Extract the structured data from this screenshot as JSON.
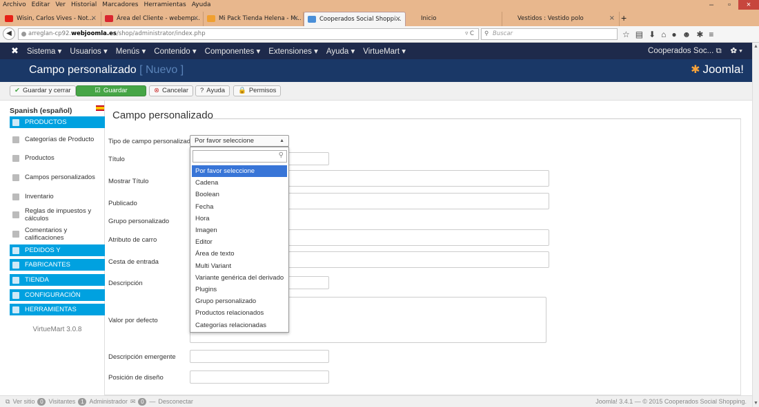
{
  "menubar": [
    "Archivo",
    "Editar",
    "Ver",
    "Historial",
    "Marcadores",
    "Herramientas",
    "Ayuda"
  ],
  "window_controls": {
    "minimize": "–",
    "restore": "▫",
    "close": "×"
  },
  "tabs": [
    {
      "title": "Wisin, Carlos Vives - Not...",
      "icon_color": "#e62117",
      "icon": "youtube-icon"
    },
    {
      "title": "Área del Cliente - webemp...",
      "icon_color": "#d9262f",
      "icon": "webempresa-icon"
    },
    {
      "title": "Mi Pack Tienda Helena - M...",
      "icon_color": "#f0a030",
      "icon": "pack-icon"
    },
    {
      "title": "Cooperados Social Shoppi...",
      "icon_color": "#4a8fd8",
      "icon": "joomla-icon"
    },
    {
      "title": "Inicio",
      "icon_color": "",
      "icon": ""
    },
    {
      "title": "Vestidos : Vestido polo",
      "icon_color": "",
      "icon": ""
    }
  ],
  "new_tab": "+",
  "url": {
    "prefix": "arreglan-cp92.",
    "domain": "webjoomla.es",
    "path": "/shop/administrator/index.php",
    "reload": "▿ C"
  },
  "search": {
    "placeholder": "Buscar",
    "icon": "⚲"
  },
  "nav_icons": [
    "☆",
    "▤",
    "⬇",
    "⌂",
    "●",
    "☻",
    "✱",
    "≡"
  ],
  "jnav": {
    "logo": "✖",
    "items": [
      "Sistema ▾",
      "Usuarios ▾",
      "Menús ▾",
      "Contenido ▾",
      "Componentes ▾",
      "Extensiones ▾",
      "Ayuda ▾",
      "VirtueMart ▾"
    ],
    "site": "Cooperados Soc... ⧉",
    "settings": "✿ ▾"
  },
  "header": {
    "title": "Campo personalizado",
    "status": "[ Nuevo ]",
    "logo": "Joomla!"
  },
  "toolbar": [
    {
      "label": "Guardar y cerrar",
      "icon": "✔"
    },
    {
      "label": "Guardar",
      "icon": "☑"
    },
    {
      "label": "Cancelar",
      "icon": "⊗"
    },
    {
      "label": "Ayuda",
      "icon": "?"
    },
    {
      "label": "Permisos",
      "icon": "🔒"
    }
  ],
  "sidebar": {
    "language": "Spanish (español)",
    "items": [
      {
        "label": "PRODUCTOS",
        "type": "cat"
      },
      {
        "label": "Categorías de Producto",
        "type": "item"
      },
      {
        "label": "Productos",
        "type": "item"
      },
      {
        "label": "Campos personalizados",
        "type": "item"
      },
      {
        "label": "Inventario",
        "type": "item"
      },
      {
        "label": "Reglas de impuestos y cálculos",
        "type": "item"
      },
      {
        "label": "Comentarios y calificaciones",
        "type": "item"
      },
      {
        "label": "PEDIDOS Y",
        "type": "cat"
      },
      {
        "label": "FABRICANTES",
        "type": "cat"
      },
      {
        "label": "TIENDA",
        "type": "cat"
      },
      {
        "label": "CONFIGURACIÓN",
        "type": "cat"
      },
      {
        "label": "HERRAMIENTAS",
        "type": "cat"
      }
    ],
    "version": "VirtueMart 3.0.8"
  },
  "form": {
    "title": "Campo personalizado",
    "labels": [
      "Tipo de campo personalizado",
      "Título",
      "Mostrar Título",
      "Publicado",
      "Grupo personalizado",
      "Atributo de carro",
      "Cesta de entrada",
      "Descripción",
      "Valor por defecto",
      "Descripción emergente",
      "Posición de diseño"
    ],
    "select_value": "Por favor seleccione",
    "options": [
      "Por favor seleccione",
      "Cadena",
      "Boolean",
      "Fecha",
      "Hora",
      "Imagen",
      "Editor",
      "Área de texto",
      "Multi Variant",
      "Variante genérica del derivado",
      "Plugins",
      "Grupo personalizado",
      "Productos relacionados",
      "Categorías relacionadas"
    ],
    "selected_index": 0
  },
  "footer": {
    "view_site": "Ver sitio",
    "visitors_count": "0",
    "visitors": "Visitantes",
    "admin_count": "1",
    "admin": "Administrador",
    "msg_count": "0",
    "logout": "Desconectar",
    "copyright": "Joomla! 3.4.1 — © 2015 Cooperados Social Shopping."
  }
}
